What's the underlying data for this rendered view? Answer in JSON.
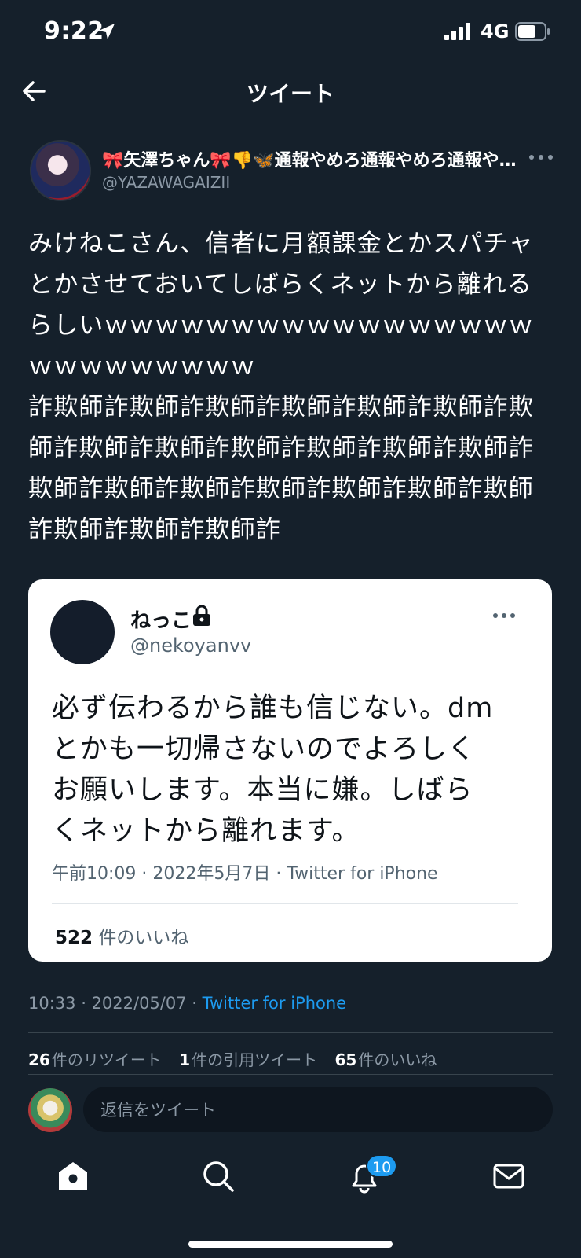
{
  "status_bar": {
    "time": "9:22",
    "network": "4G"
  },
  "header": {
    "title": "ツイート"
  },
  "tweet": {
    "display_name": "🎀矢澤ちゃん🎀👎🦋通報やめろ通報やめろ通報やめろ",
    "handle": "@YAZAWAGAIZII",
    "text": "みけねこさん、信者に月額課金とかスパチャとかさせておいてしばらくネットから離れるらしいｗｗｗｗｗｗｗｗｗｗｗｗｗｗｗｗｗｗｗｗｗｗｗｗｗｗ\n詐欺師詐欺師詐欺師詐欺師詐欺師詐欺師詐欺師詐欺師詐欺師詐欺師詐欺師詐欺師詐欺師詐欺師詐欺師詐欺師詐欺師詐欺師詐欺師詐欺師詐欺師詐欺師詐欺師詐",
    "timestamp": "10:33 · 2022/05/07 · ",
    "source": "Twitter for iPhone",
    "stats": {
      "retweets_count": "26",
      "retweets_label": "件のリツイート",
      "quotes_count": "1",
      "quotes_label": "件の引用ツイート",
      "likes_count": "65",
      "likes_label": "件のいいね"
    }
  },
  "embedded": {
    "name": "ねっこ",
    "handle": "@nekoyanvv",
    "text": "必ず伝わるから誰も信じない。dm\nとかも一切帰さないのでよろしく\nお願いします。本当に嫌。しばら\nくネットから離れます。",
    "meta": "午前10:09 · 2022年5月7日 · Twitter for iPhone",
    "likes_count": "522",
    "likes_label": " 件のいいね"
  },
  "reply": {
    "placeholder": "返信をツイート"
  },
  "nav": {
    "notification_badge": "10"
  }
}
